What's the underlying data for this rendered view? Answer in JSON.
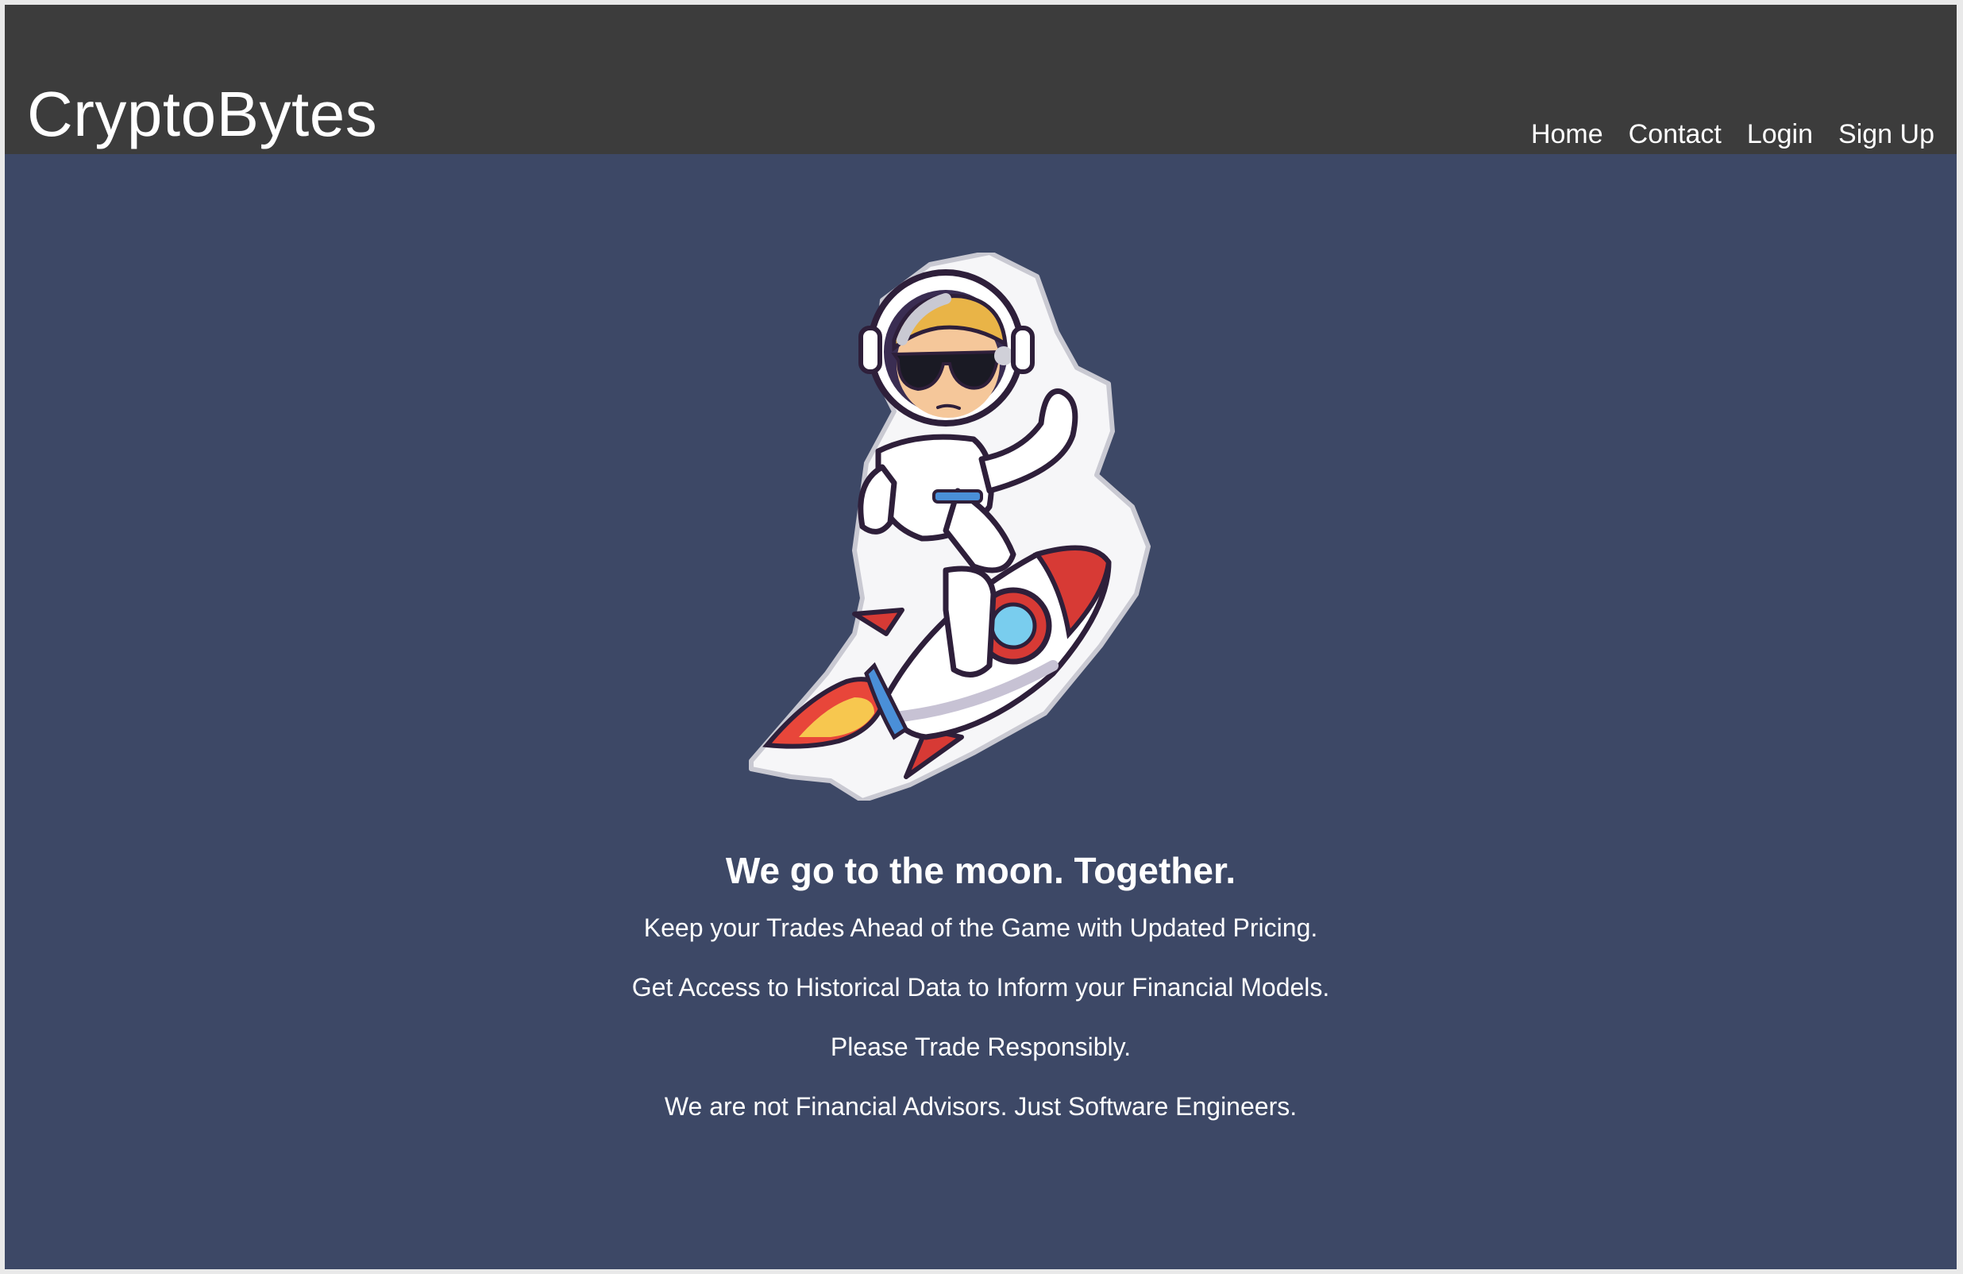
{
  "header": {
    "brand": "CryptoBytes",
    "nav": [
      {
        "label": "Home"
      },
      {
        "label": "Contact"
      },
      {
        "label": "Login"
      },
      {
        "label": "Sign Up"
      }
    ]
  },
  "hero": {
    "illustration": "astronaut-riding-rocket-icon",
    "headline": "We go to the moon. Together.",
    "lines": [
      "Keep your Trades Ahead of the Game with Updated Pricing.",
      "Get Access to Historical Data to Inform your Financial Models.",
      "Please Trade Responsibly.",
      "We are not Financial Advisors. Just Software Engineers."
    ]
  },
  "colors": {
    "navbar": "#3c3c3c",
    "background": "#3d4866",
    "text": "#ffffff"
  }
}
